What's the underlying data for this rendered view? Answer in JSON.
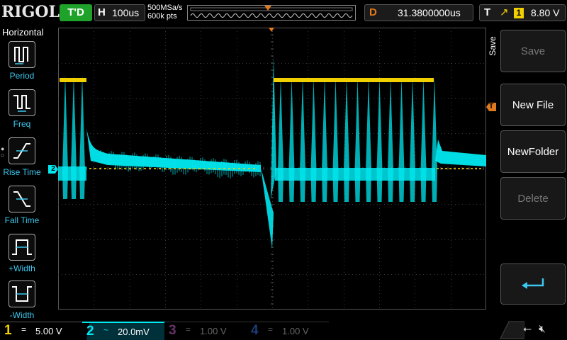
{
  "brand": "RIGOL",
  "top": {
    "trigger_state": "T'D",
    "horizontal_letter": "H",
    "timebase": "100us",
    "sample_rate": "500MSa/s",
    "memory_depth": "600k pts",
    "delay_letter": "D",
    "delay": "31.3800000us",
    "trigger_letter": "T",
    "trigger_edge": "rising-edge-icon",
    "trigger_source": "1",
    "trigger_level": "8.80 V"
  },
  "left_menu": {
    "title": "Horizontal",
    "items": [
      {
        "label": "Period",
        "icon": "period-icon"
      },
      {
        "label": "Freq",
        "icon": "freq-icon"
      },
      {
        "label": "Rise Time",
        "icon": "rise-time-icon"
      },
      {
        "label": "Fall Time",
        "icon": "fall-time-icon"
      },
      {
        "label": "+Width",
        "icon": "positive-width-icon"
      },
      {
        "label": "-Width",
        "icon": "negative-width-icon"
      }
    ]
  },
  "right_menu": {
    "tab": "Save",
    "buttons": [
      {
        "label": "Save",
        "state": "disabled"
      },
      {
        "label": "New File",
        "state": "enabled"
      },
      {
        "label": "NewFolder",
        "state": "enabled"
      },
      {
        "label": "Delete",
        "state": "disabled"
      }
    ],
    "enter_icon": "enter-arrow-icon"
  },
  "channels": [
    {
      "num": "1",
      "coupling": "=",
      "scale": "5.00 V",
      "color": "#f0d000",
      "active": true
    },
    {
      "num": "2",
      "coupling": "~",
      "scale": "20.0mV",
      "color": "#00e8f0",
      "active": true
    },
    {
      "num": "3",
      "coupling": "=",
      "scale": "1.00 V",
      "color": "#c060c0",
      "active": false
    },
    {
      "num": "4",
      "coupling": "=",
      "scale": "1.00 V",
      "color": "#3070e0",
      "active": false
    }
  ],
  "markers": {
    "ch2_marker": "2",
    "trigger_marker": "T"
  },
  "colors": {
    "ch1": "#f0d000",
    "ch2": "#00e8f0",
    "trigger": "#e07a1f",
    "grid": "#3a3a3a",
    "trig_state_bg": "#1fa22a"
  },
  "system_icons": [
    "usb-icon",
    "mute-speaker-icon"
  ]
}
